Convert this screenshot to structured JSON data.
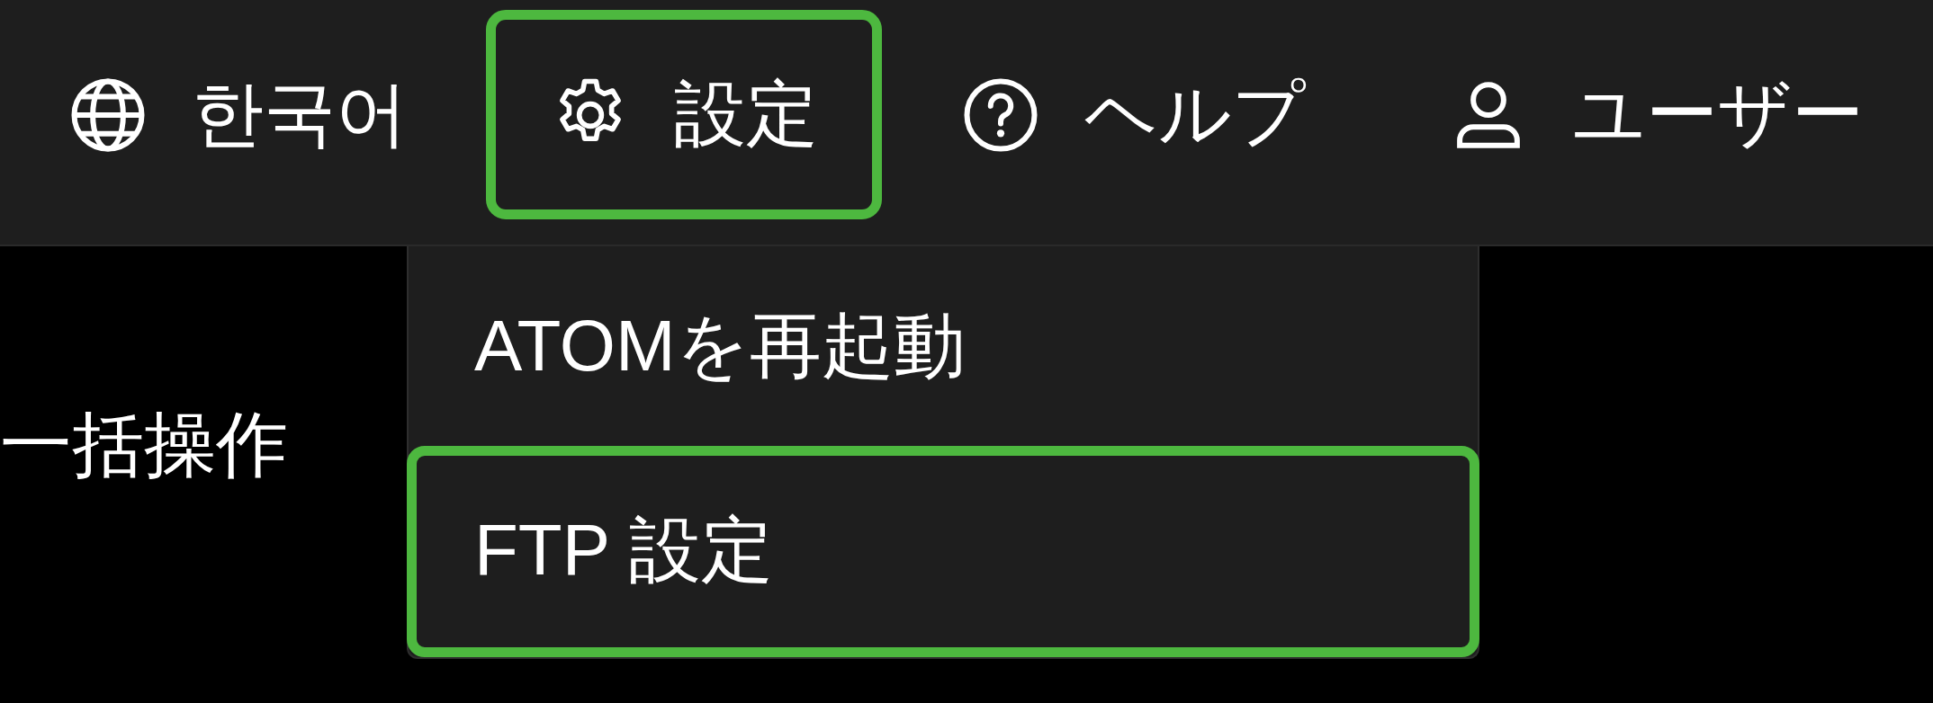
{
  "nav": [
    {
      "kind": "language",
      "label": "한국어",
      "highlighted": false
    },
    {
      "kind": "settings",
      "label": "設定",
      "highlighted": true
    },
    {
      "kind": "help",
      "label": "ヘルプ",
      "highlighted": false
    },
    {
      "kind": "user",
      "label": "ユーザー",
      "highlighted": false
    }
  ],
  "settings_menu": [
    {
      "label": "ATOMを再起動",
      "highlighted": false
    },
    {
      "label": "FTP 設定",
      "highlighted": true
    }
  ],
  "page": {
    "heading": "一括操作"
  }
}
